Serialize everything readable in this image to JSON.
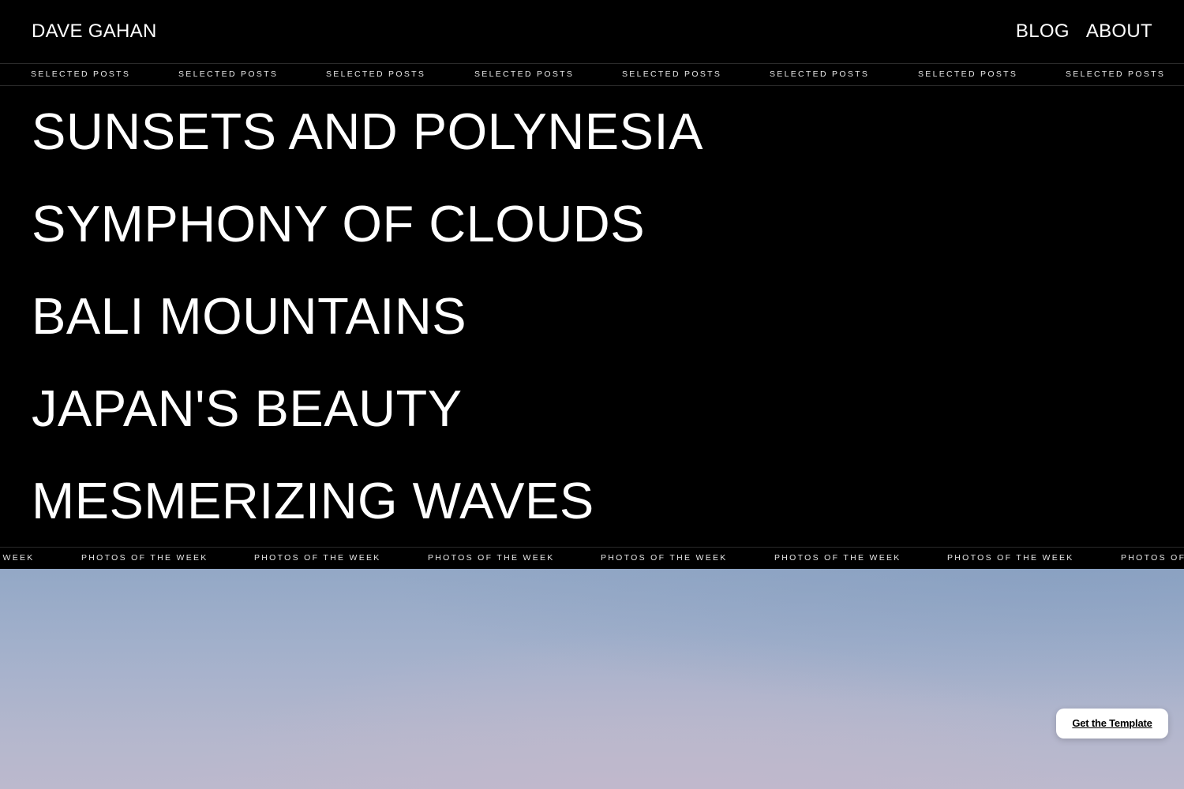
{
  "header": {
    "brand": "DAVE GAHAN",
    "nav": [
      "BLOG",
      "ABOUT"
    ]
  },
  "ticker_top": {
    "label": "SELECTED POSTS"
  },
  "posts": [
    "SUNSETS AND POLYNESIA",
    "SYMPHONY OF CLOUDS",
    "BALI MOUNTAINS",
    "JAPAN'S BEAUTY",
    "MESMERIZING WAVES"
  ],
  "ticker_bottom": {
    "label": "PHOTOS OF THE WEEK"
  },
  "cta": {
    "label": "Get the Template"
  }
}
